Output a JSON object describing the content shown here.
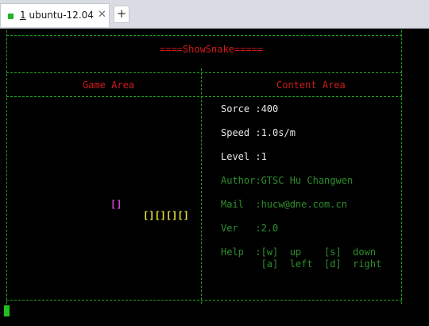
{
  "tab": {
    "number": "1",
    "title": "ubuntu-12.04",
    "close": "✕"
  },
  "new_tab": "+",
  "game": {
    "header": "====ShowSnake=====",
    "game_area_label": "Game Area",
    "content_area_label": "Content Area",
    "food": "[]",
    "snake": "[][][][]",
    "score_line": "Sorce :400",
    "speed_line": "Speed :1.0s/m",
    "level_line": "Level :1",
    "author_line": "Author:GTSC Hu Changwen",
    "mail_line": "Mail  :hucw@dne.com.cn",
    "ver_line": "Ver   :2.0",
    "help_line1": "Help  :[w]  up    [s]  down",
    "help_line2": "       [a]  left  [d]  right"
  },
  "colors": {
    "border": "#1ea31e",
    "title": "#d21b1b",
    "food": "#d23fd2",
    "snake": "#e5e03a",
    "stats": "#e8e8e8",
    "info": "#2c8f2c"
  }
}
